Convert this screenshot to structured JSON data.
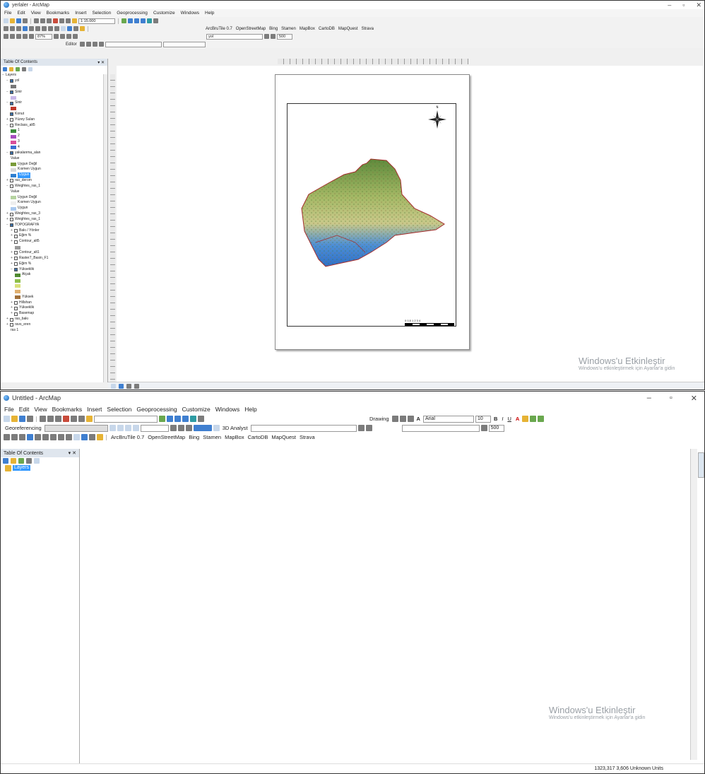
{
  "window1": {
    "title": "yerlaler - ArcMap",
    "menu": [
      "File",
      "Edit",
      "View",
      "Bookmarks",
      "Insert",
      "Selection",
      "Geoprocessing",
      "Customize",
      "Windows",
      "Help"
    ],
    "scale_value": "1:15.000",
    "zoom_value": "87%",
    "editor_label": "Editor",
    "basemap_toolbar": [
      "ArcBruTile 0.7",
      "OpenStreetMap",
      "Bing",
      "Stamen",
      "MapBox",
      "CartoDB",
      "MapQuest",
      "Strava"
    ],
    "layer_combo": "yol",
    "toolbar_num": "500",
    "toc": {
      "header": "Table Of Contents",
      "rows": [
        {
          "label": "Layers",
          "level": 0,
          "expand": "−",
          "check": null
        },
        {
          "label": "yol",
          "level": 1,
          "expand": "−",
          "check": true
        },
        {
          "label": "",
          "level": 2,
          "swatch": "#777777"
        },
        {
          "label": "Sinir",
          "level": 1,
          "expand": "−",
          "check": true
        },
        {
          "label": "",
          "level": 2,
          "swatch": "#c9b7e8"
        },
        {
          "label": "Sinir",
          "level": 1,
          "expand": "−",
          "check": true
        },
        {
          "label": "",
          "level": 2,
          "swatch": "#c0392b"
        },
        {
          "label": "Konut",
          "level": 1,
          "expand": "",
          "check": true
        },
        {
          "label": "Yüzey Sulan",
          "level": 1,
          "expand": "+",
          "check": false
        },
        {
          "label": "Reclass_alt5",
          "level": 1,
          "expand": "−",
          "check": false
        },
        {
          "label": "1",
          "level": 2,
          "swatch": "#3c8d3c"
        },
        {
          "label": "2",
          "level": 2,
          "swatch": "#a64dbf"
        },
        {
          "label": "3",
          "level": 2,
          "swatch": "#d94f9a"
        },
        {
          "label": "4",
          "level": 2,
          "swatch": "#3b6fd1"
        },
        {
          "label": "yakalanma_alan",
          "level": 1,
          "expand": "−",
          "check": true
        },
        {
          "label": "Value",
          "level": 2
        },
        {
          "label": "Uygun Değil",
          "level": 2,
          "swatch": "#7a9b3a"
        },
        {
          "label": "Kısmen Uygun",
          "level": 2,
          "swatch": "#d8d8d8"
        },
        {
          "label": "Uygun",
          "level": 2,
          "swatch": "#2f7fd0",
          "selected": true
        },
        {
          "label": "ras_derom",
          "level": 1,
          "expand": "+",
          "check": false
        },
        {
          "label": "Weightes_ras_1",
          "level": 1,
          "expand": "−",
          "check": false
        },
        {
          "label": "Value",
          "level": 2
        },
        {
          "label": "Uygun Değil",
          "level": 2,
          "swatch": "#b5d3a0"
        },
        {
          "label": "Kısmen Uygun",
          "level": 2,
          "swatch": "#eeeeee"
        },
        {
          "label": "Uygun",
          "level": 2,
          "swatch": "#a9c9ef"
        },
        {
          "label": "Weightes_ras_3",
          "level": 1,
          "expand": "+",
          "check": false
        },
        {
          "label": "Weightes_ras_1",
          "level": 1,
          "expand": "+",
          "check": false
        },
        {
          "label": "TOPOGRAFYA",
          "level": 1,
          "expand": "−",
          "check": true
        },
        {
          "label": "Bakı / Yönler",
          "level": 2,
          "expand": "+",
          "check": false
        },
        {
          "label": "Eğim %",
          "level": 2,
          "expand": "+",
          "check": false
        },
        {
          "label": "Contour_alt5",
          "level": 2,
          "expand": "+",
          "check": false
        },
        {
          "label": "",
          "level": 3,
          "swatch": "#999999"
        },
        {
          "label": "Contour_alt1",
          "level": 2,
          "expand": "+",
          "check": false
        },
        {
          "label": "Raster7_Basin_F1",
          "level": 2,
          "expand": "+",
          "check": false
        },
        {
          "label": "Eğim %",
          "level": 2,
          "expand": "+",
          "check": false
        },
        {
          "label": "Yükseklik",
          "level": 2,
          "expand": "−",
          "check": true
        },
        {
          "label": "Alçak",
          "level": 3,
          "swatch": "#4f8a2f"
        },
        {
          "label": "",
          "level": 3,
          "swatch": "#8fbf4a"
        },
        {
          "label": "",
          "level": 3,
          "swatch": "#d9e07a"
        },
        {
          "label": "",
          "level": 3,
          "swatch": "#e0b070"
        },
        {
          "label": "Yüksek",
          "level": 3,
          "swatch": "#a0703a"
        },
        {
          "label": "Hillshan",
          "level": 2,
          "expand": "+",
          "check": false
        },
        {
          "label": "Yükseklik",
          "level": 2,
          "expand": "+",
          "check": false
        },
        {
          "label": "Basemap",
          "level": 2,
          "expand": "+",
          "check": false
        },
        {
          "label": "ras_bakı",
          "level": 1,
          "expand": "+",
          "check": false
        },
        {
          "label": "ravs_eren",
          "level": 1,
          "expand": "+",
          "check": false
        },
        {
          "label": "ras 1",
          "level": 2
        }
      ]
    },
    "north_arrow_letter": "N",
    "scalebar_label": "0 0,5 1 2 3 4"
  },
  "window2": {
    "title": "Untitled - ArcMap",
    "menu": [
      "File",
      "Edit",
      "View",
      "Bookmarks",
      "Insert",
      "Selection",
      "Geoprocessing",
      "Customize",
      "Windows",
      "Help"
    ],
    "drawing_label": "Drawing",
    "font_name": "Arial",
    "font_size": "10",
    "georeferencing_label": "Georeferencing",
    "analyst_label": "3D Analyst",
    "basemap_toolbar": [
      "ArcBruTile 0.7",
      "OpenStreetMap",
      "Bing",
      "Stamen",
      "MapBox",
      "CartoDB",
      "MapQuest",
      "Strava"
    ],
    "toolbar_num": "500",
    "toc": {
      "header": "Table Of Contents",
      "layers_label": "Layers"
    },
    "status_coords": "1323,317  3,606 Unknown Units"
  },
  "watermark": {
    "title": "Windows'u Etkinleştir",
    "subtitle": "Windows'u etkinleştirmek için Ayarlar'a gidin"
  },
  "colors": {
    "selection": "#3399ff",
    "toc_header": "#dfe6ee",
    "study_area_outline": "#a52a2a"
  }
}
